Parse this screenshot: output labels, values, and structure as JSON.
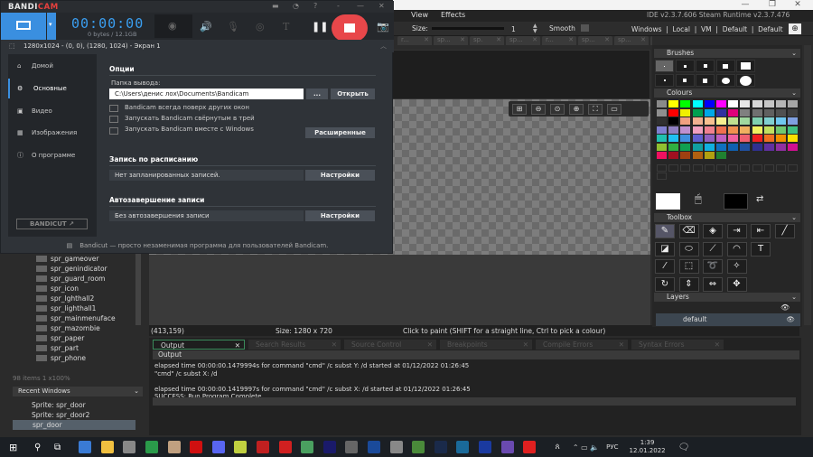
{
  "gamemaker": {
    "window_controls": [
      "—",
      "❐",
      "✕"
    ],
    "menu": [
      "View",
      "Effects"
    ],
    "version": "IDE v2.3.7.606 Steam  Runtime v2.3.7.476",
    "toolbar": {
      "size_label": "Size:",
      "size_value": "1",
      "smooth_label": "Smooth",
      "smooth_checked": false,
      "targets": "Windows  |  Local  |  VM  |  Default  |  Default"
    },
    "doc_tabs": [
      "r...",
      "sp...",
      "sp.",
      "sp...",
      "r...",
      "sp...",
      "sp...",
      "W...",
      "r...",
      "sp...",
      "sp..."
    ],
    "status": {
      "coords": "(413,159)",
      "size": "Size: 1280 x 720",
      "hint": "Click to paint (SHIFT for a straight line, Ctrl to pick a colour)"
    },
    "output_tabs": [
      "Output",
      "Search Results",
      "Source Control",
      "Breakpoints",
      "Compile Errors",
      "Syntax Errors"
    ],
    "output_header": "Output",
    "output_lines": [
      "elapsed time 00:00:00.1479994s for command \"cmd\" /c subst Y: /d started at 01/12/2022 01:26:45",
      "\"cmd\"  /c subst X: /d",
      "",
      "elapsed time 00:00:00.1419997s for command \"cmd\" /c subst X: /d started at 01/12/2022 01:26:45",
      "SUCCESS: Run Program Complete"
    ],
    "assets": [
      "spr_gameover",
      "spr_genindicator",
      "spr_guard_room",
      "spr_icon",
      "spr_lghthall2",
      "spr_lighthall1",
      "spr_mainmenuface",
      "spr_mazombie",
      "spr_paper",
      "spr_part",
      "spr_phone"
    ],
    "assets_footer": "98 items   1 x100%",
    "recent_windows": {
      "title": "Recent Windows",
      "items": [
        "Sprite: spr_door",
        "Sprite: spr_door2",
        "spr_door"
      ]
    },
    "panels": {
      "brushes": "Brushes",
      "colours": "Colours",
      "toolbox": "Toolbox",
      "layers": "Layers"
    },
    "layer": "default",
    "palette": [
      [
        "#8a8a8a",
        "#ffff00",
        "#00ff00",
        "#00ffff",
        "#0000ff",
        "#ff00ff",
        "#ffffff",
        "#e6e6e6",
        "#d6d6d6",
        "#c6c6c6",
        "#b6b6b6",
        "#a6a6a6"
      ],
      [
        "#8f8f8f",
        "#ff0000",
        "#f0f000",
        "#00a050",
        "#00a8e8",
        "#3030a0",
        "#e0007a",
        "#808080",
        "#707070",
        "#606060",
        "#505050",
        "#404040"
      ],
      [
        "#303030",
        "#000000",
        "#f0a080",
        "#f0b090",
        "#f8c090",
        "#f8f090",
        "#c0e090",
        "#a0d8a0",
        "#80d0b0",
        "#80d0d0",
        "#70c8f0",
        "#80a0e0"
      ],
      [
        "#8080d0",
        "#9080c0",
        "#c090d0",
        "#f0a0c0",
        "#f08090",
        "#f07050",
        "#f09050",
        "#f0b060",
        "#f0f060",
        "#c0e060",
        "#70c870",
        "#40c080"
      ],
      [
        "#20c0b0",
        "#20c0f0",
        "#4090e0",
        "#6060d0",
        "#9060c0",
        "#c060c0",
        "#f060a0",
        "#f06070",
        "#f02020",
        "#f07020",
        "#f09000",
        "#f8e000"
      ],
      [
        "#90c030",
        "#30b040",
        "#10a050",
        "#10a0a0",
        "#10b0e0",
        "#1070c0",
        "#1060b0",
        "#2050a0",
        "#303090",
        "#6030a0",
        "#9030a0",
        "#d01090"
      ],
      [
        "#f01060",
        "#a01020",
        "#a04010",
        "#b06010",
        "#b0a010",
        "#208030"
      ]
    ],
    "primary_colour": "#ffffff",
    "secondary_colour": "#000000",
    "tools": [
      {
        "icon": "pencil-icon",
        "glyph": "✎"
      },
      {
        "icon": "eraser-icon",
        "glyph": "⌫"
      },
      {
        "icon": "fill-icon",
        "glyph": "◈"
      },
      {
        "icon": "copy-icon",
        "glyph": "⇥"
      },
      {
        "icon": "paste-icon",
        "glyph": "⇤"
      },
      {
        "icon": "line-icon",
        "glyph": "╱"
      },
      {
        "icon": "rectangle-icon",
        "glyph": "◪"
      },
      {
        "icon": "ellipse-icon",
        "glyph": "⬭"
      },
      {
        "icon": "polygon-icon",
        "glyph": "⟋"
      },
      {
        "icon": "arc-icon",
        "glyph": "◠"
      },
      {
        "icon": "text-icon",
        "glyph": "T"
      },
      {
        "icon": "eyedropper-icon",
        "glyph": "⁄"
      },
      {
        "icon": "select-icon",
        "glyph": "⬚"
      },
      {
        "icon": "lasso-icon",
        "glyph": "➰"
      },
      {
        "icon": "magic-wand-icon",
        "glyph": "✧"
      },
      {
        "icon": "rotate-icon",
        "glyph": "↻"
      },
      {
        "icon": "flip-vertical-icon",
        "glyph": "⇕"
      },
      {
        "icon": "flip-horizontal-icon",
        "glyph": "⇔"
      },
      {
        "icon": "move-icon",
        "glyph": "✥"
      }
    ]
  },
  "bandicam": {
    "logo": {
      "a": "BANDI",
      "b": "CAM"
    },
    "timer": "00:00:00",
    "size": "0 bytes / 12.1GB",
    "region": "1280x1024 - (0, 0), (1280, 1024) - Экран 1",
    "nav": [
      "Домой",
      "Основные",
      "Видео",
      "Изображения",
      "О программе"
    ],
    "active_nav": "Основные",
    "bandicut": "BANDICUT ↗",
    "options_title": "Опции",
    "folder_label": "Папка вывода:",
    "folder_value": "C:\\Users\\денис лох\\Documents\\Bandicam",
    "browse": "...",
    "open": "Открыть",
    "checks": [
      "Bandicam всегда поверх других окон",
      "Запускать Bandicam свёрнутым в трей",
      "Запускать Bandicam вместе с Windows"
    ],
    "advanced": "Расширенные",
    "schedule_title": "Запись по расписанию",
    "schedule_value": "Нет запланированных записей.",
    "settings": "Настройки",
    "autostop_title": "Автозавершение записи",
    "autostop_value": "Без автозавершения записи",
    "footer": "Bandicut — просто незаменимая программа для пользователей Bandicam.",
    "accent": "#3a8fe0",
    "record_color": "#e8474a"
  },
  "taskbar": {
    "lang": "РУС",
    "time": "1:39",
    "date": "12.01.2022",
    "icons": [
      "#3a7bd5",
      "#f0c040",
      "#888",
      "#2a9a4a",
      "#c0a080",
      "#d01010",
      "#5865f2",
      "#c0d040",
      "#c02020",
      "#d02020",
      "#4aa060",
      "#1a1a6a",
      "#666",
      "#1a4a9a",
      "#888",
      "#4a8a3a",
      "#1a2a4a",
      "#1a6a9a",
      "#1a3aa0",
      "#6a4ab0",
      "#e02020"
    ]
  }
}
